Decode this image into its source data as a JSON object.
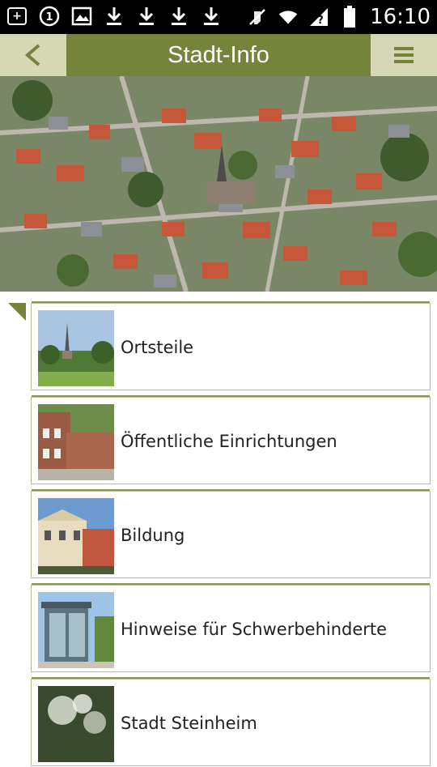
{
  "status_bar": {
    "time": "16:10",
    "icons": [
      "add-box-icon",
      "one-circle-icon",
      "image-icon",
      "download-icon",
      "download-icon",
      "download-icon",
      "download-icon",
      "mute-icon",
      "wifi-icon",
      "signal-unknown-icon",
      "battery-icon"
    ]
  },
  "header": {
    "title": "Stadt-Info",
    "back_icon": "back-chevron-icon",
    "menu_icon": "hamburger-menu-icon",
    "accent_color": "#76833a",
    "button_bg": "#d6d7b4"
  },
  "menu": {
    "items": [
      {
        "label": "Ortsteile"
      },
      {
        "label": "Öffentliche Einrichtungen"
      },
      {
        "label": "Bildung"
      },
      {
        "label": "Hinweise für Schwerbehinderte"
      },
      {
        "label": "Stadt Steinheim"
      }
    ]
  }
}
